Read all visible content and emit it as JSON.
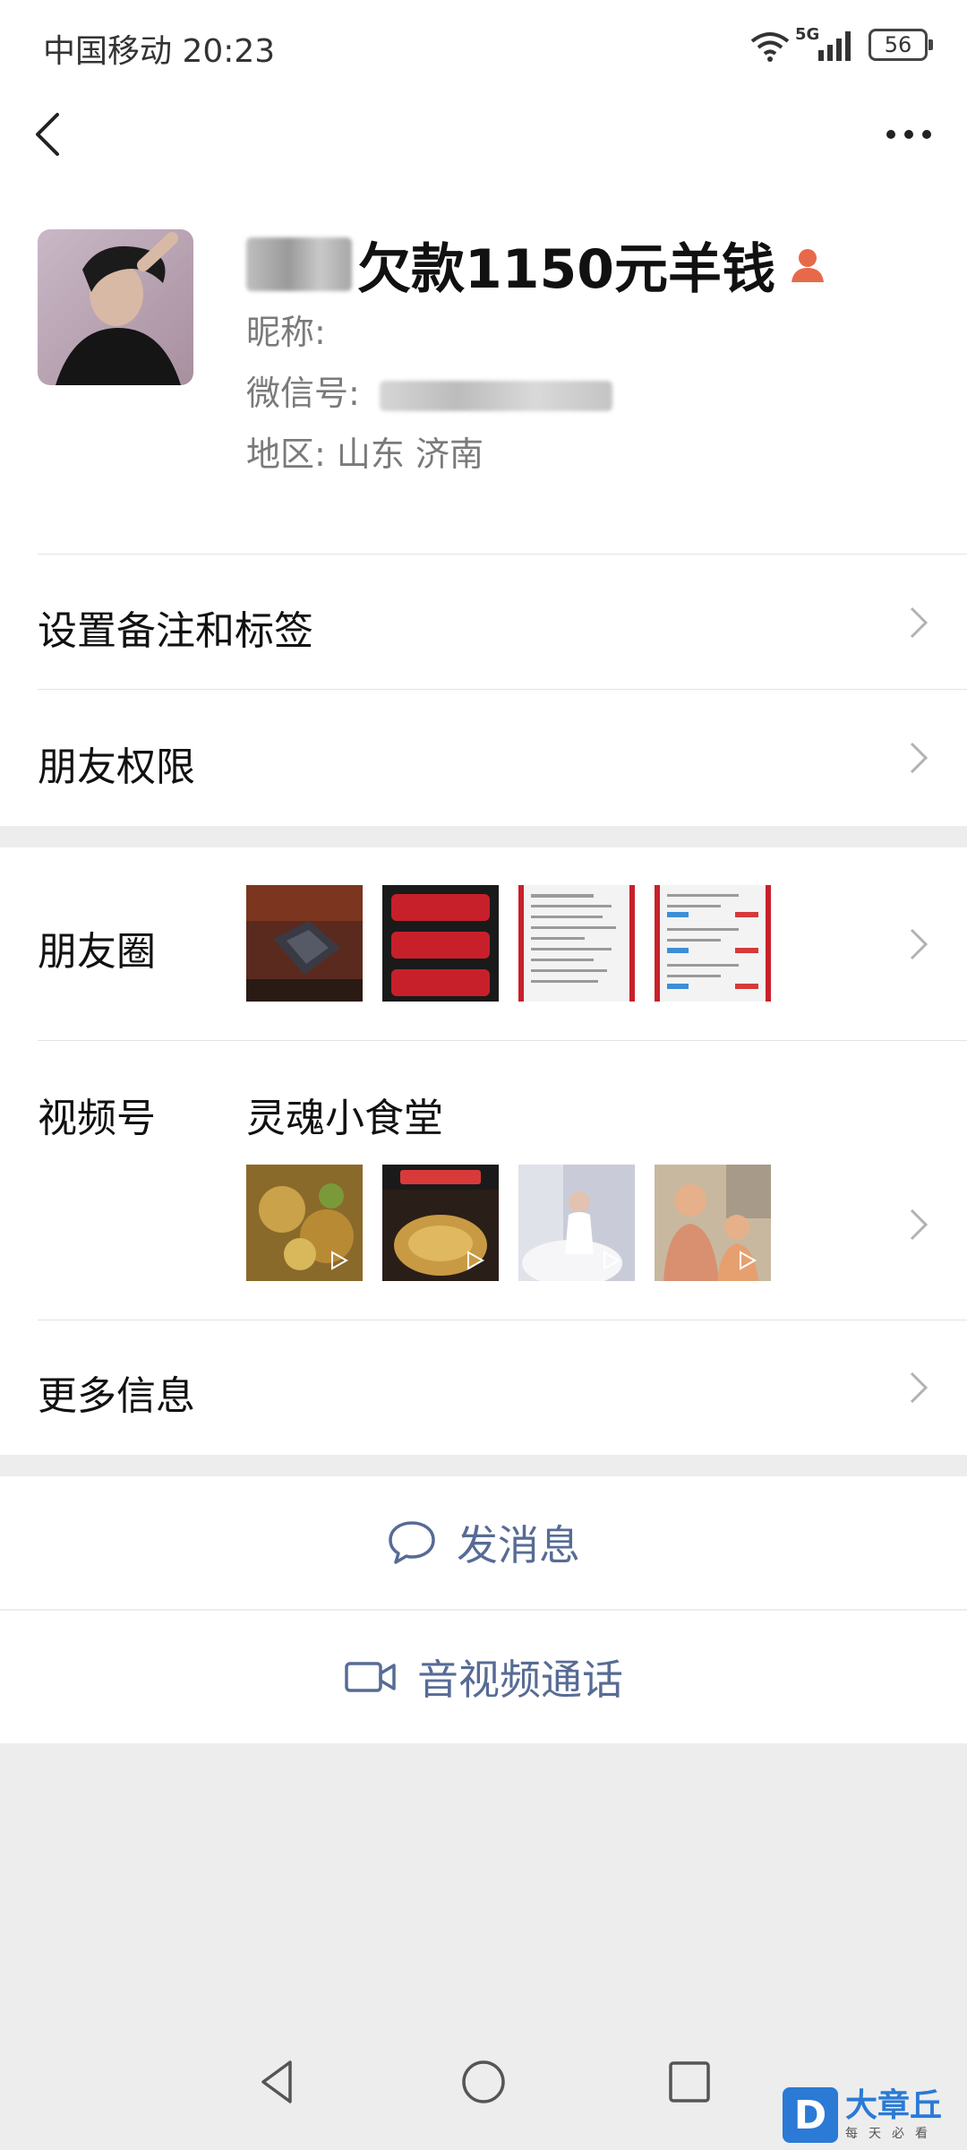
{
  "status_bar": {
    "carrier_time": "中国移动 20:23",
    "network": "5G",
    "battery": "56"
  },
  "profile": {
    "name_visible": "欠款1150元羊钱",
    "nickname_label": "昵称:",
    "wechat_id_label": "微信号:",
    "region": "地区:  山东  济南"
  },
  "rows": {
    "remark_tags": "设置备注和标签",
    "friend_permissions": "朋友权限",
    "moments": "朋友圈",
    "channels": "视频号",
    "channels_name": "灵魂小食堂",
    "more_info": "更多信息"
  },
  "actions": {
    "send_message": "发消息",
    "video_call": "音视频通话"
  },
  "watermark": {
    "logo": "D",
    "title": "大章丘",
    "subtitle": "每天必看"
  },
  "colors": {
    "link_blue": "#576b95",
    "background": "#ededed",
    "person_icon": "#e8694a"
  }
}
